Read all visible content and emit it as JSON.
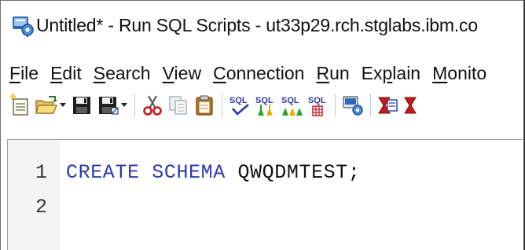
{
  "window": {
    "title": "Untitled* - Run SQL Scripts - ut33p29.rch.stglabs.ibm.co"
  },
  "menu": {
    "items": [
      {
        "label": "File",
        "accel_index": 0
      },
      {
        "label": "Edit",
        "accel_index": 0
      },
      {
        "label": "Search",
        "accel_index": 0
      },
      {
        "label": "View",
        "accel_index": 0
      },
      {
        "label": "Connection",
        "accel_index": 0
      },
      {
        "label": "Run",
        "accel_index": 0
      },
      {
        "label": "Explain",
        "accel_index": 2
      },
      {
        "label": "Monito",
        "accel_index": 0
      }
    ]
  },
  "toolbar": {
    "icons": [
      "new-script-icon",
      "open-folder-icon",
      "save-icon",
      "save-as-icon",
      "cut-icon",
      "copy-icon",
      "paste-icon",
      "check-syntax-icon",
      "run-all-icon",
      "run-from-selected-icon",
      "run-selected-icon",
      "connection-settings-icon",
      "visual-explain-icon"
    ],
    "sql_label": "SQL"
  },
  "editor": {
    "lines": [
      {
        "number": "1",
        "keyword1": "CREATE",
        "keyword2": "SCHEMA",
        "identifier": "QWQDMTEST;"
      },
      {
        "number": "2"
      }
    ]
  },
  "colors": {
    "keyword": "#2f3aa8",
    "gutter": "#f4f4f4",
    "text": "#111111"
  }
}
